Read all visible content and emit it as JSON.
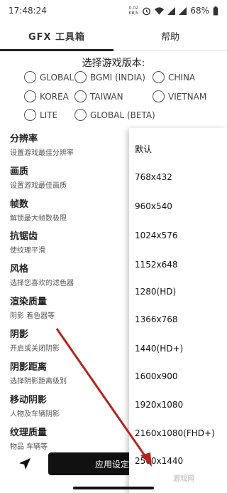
{
  "status_bar": {
    "time": "17:48:24",
    "speed": "0.02",
    "speed_unit": "KB/S",
    "battery": "68%",
    "icons": [
      "alarm-icon",
      "wifi-icon",
      "signal-icon",
      "signal-icon",
      "battery-icon"
    ]
  },
  "tabs": [
    {
      "label": "GFX 工具箱",
      "active": true
    },
    {
      "label": "帮助",
      "active": false
    }
  ],
  "version": {
    "title": "选择游戏版本:",
    "options": [
      "GLOBAL",
      "BGMI (INDIA)",
      "CHINA",
      "KOREA",
      "TAIWAN",
      "VIETNAM",
      "LITE",
      "GLOBAL (BETA)"
    ]
  },
  "settings": [
    {
      "title": "分辨率",
      "subtitle": "设置游戏最佳分辨率"
    },
    {
      "title": "画质",
      "subtitle": "设置游戏最佳画质"
    },
    {
      "title": "帧数",
      "subtitle": "解锁最大帧数极限"
    },
    {
      "title": "抗锯齿",
      "subtitle": "使纹理平滑"
    },
    {
      "title": "风格",
      "subtitle": "选择您喜欢的滤色器"
    },
    {
      "title": "渲染质量",
      "subtitle": "阴影 着色器等"
    },
    {
      "title": "阴影",
      "subtitle": "开启或关闭阴影"
    },
    {
      "title": "阴影距离",
      "subtitle": "选择阴影距离级别"
    },
    {
      "title": "移动阴影",
      "subtitle": "人物及车辆阴影"
    },
    {
      "title": "纹理质量",
      "subtitle": "物品 车辆等"
    }
  ],
  "resolution_dropdown": {
    "options": [
      "默认",
      "768x432",
      "960x540",
      "1024x576",
      "1152x648",
      "1280(HD)",
      "1366x768",
      "1440(HD+)",
      "1600x900",
      "1920x1080",
      "2160x1080(FHD+)",
      "2560x1440"
    ]
  },
  "bottom": {
    "apply_label": "应用设定",
    "send_icon": "send-icon"
  },
  "watermark": "游戏网",
  "colors": {
    "arrow": "#b3261e",
    "button_bg": "#111111",
    "tab_indicator": "#222222"
  }
}
